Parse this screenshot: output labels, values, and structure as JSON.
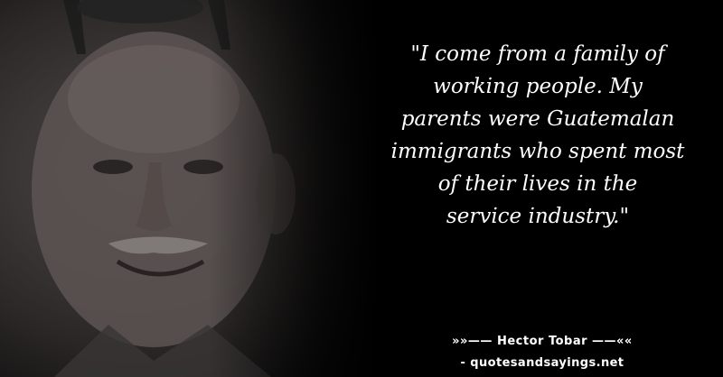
{
  "quote": {
    "lines": [
      "\"I come from a family of",
      "working people. My",
      "parents were Guatemalan",
      "immigrants who spent most",
      "of their lives in the",
      "service industry.\""
    ]
  },
  "attribution": {
    "author": "»»—— Hector Tobar ——««",
    "site": "- quotesandsayings.net"
  },
  "colors": {
    "background": "#000000",
    "text": "#ffffff"
  }
}
